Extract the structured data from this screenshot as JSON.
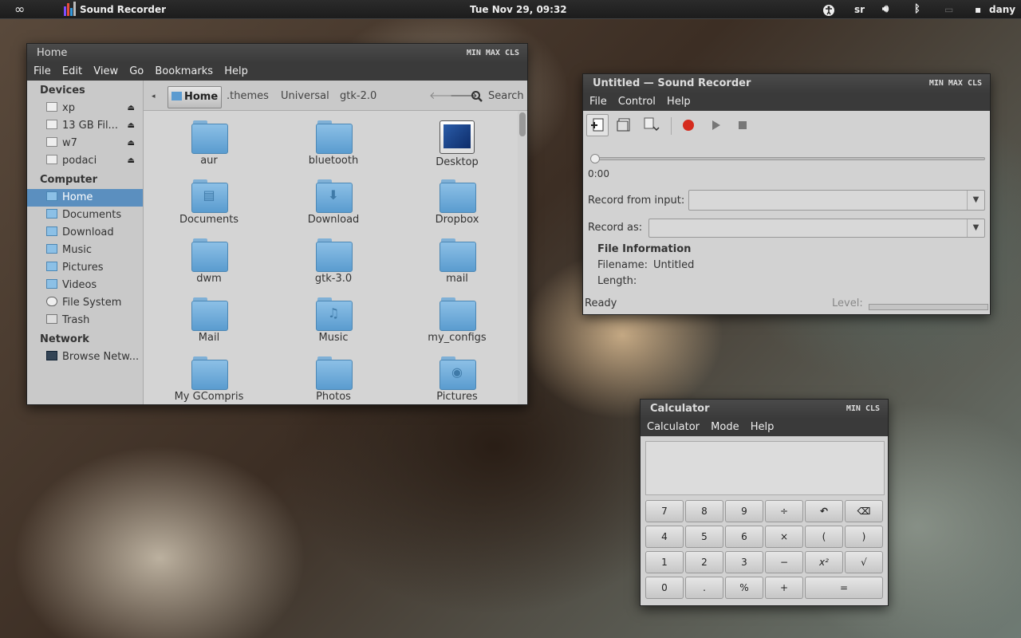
{
  "topbar": {
    "app_name": "Sound Recorder",
    "clock": "Tue Nov 29, 09:32",
    "keyboard": "sr",
    "user": "dany"
  },
  "file_manager": {
    "title": "Home",
    "window_controls": {
      "min": "MIN",
      "max": "MAX",
      "close": "CLS"
    },
    "menu": [
      "File",
      "Edit",
      "View",
      "Go",
      "Bookmarks",
      "Help"
    ],
    "sidebar": {
      "devices_heading": "Devices",
      "devices": [
        "xp",
        "13 GB Fil...",
        "w7",
        "podaci"
      ],
      "computer_heading": "Computer",
      "computer": [
        "Home",
        "Documents",
        "Download",
        "Music",
        "Pictures",
        "Videos",
        "File System",
        "Trash"
      ],
      "selected": "Home",
      "network_heading": "Network",
      "network": [
        "Browse Netw..."
      ]
    },
    "breadcrumbs": [
      "Home",
      ".themes",
      "Universal",
      "gtk-2.0"
    ],
    "search_label": "Search",
    "items": [
      "aur",
      "bluetooth",
      "Desktop",
      "Documents",
      "Download",
      "Dropbox",
      "dwm",
      "gtk-3.0",
      "mail",
      "Mail",
      "Music",
      "my_configs",
      "My GCompris",
      "Photos",
      "Pictures"
    ]
  },
  "sound_recorder": {
    "title": "Untitled — Sound Recorder",
    "window_controls": {
      "min": "MIN",
      "max": "MAX",
      "close": "CLS"
    },
    "menu": [
      "File",
      "Control",
      "Help"
    ],
    "position": "0:00",
    "record_from_label": "Record from input:",
    "record_as_label": "Record as:",
    "file_info_heading": "File Information",
    "filename_label": "Filename:",
    "filename_value": "Untitled",
    "length_label": "Length:",
    "status": "Ready",
    "level_label": "Level:",
    "accent": "#d52b1e"
  },
  "calculator": {
    "title": "Calculator",
    "window_controls": {
      "min": "MIN",
      "close": "CLS"
    },
    "menu": [
      "Calculator",
      "Mode",
      "Help"
    ],
    "display": "",
    "keys": [
      "7",
      "8",
      "9",
      "÷",
      "undo",
      "backspace",
      "4",
      "5",
      "6",
      "×",
      "(",
      ")",
      "1",
      "2",
      "3",
      "−",
      "x²",
      "√",
      "0",
      ".",
      "%",
      "+",
      "="
    ]
  }
}
